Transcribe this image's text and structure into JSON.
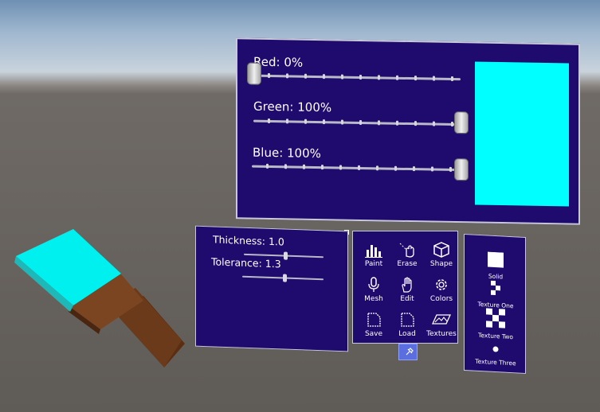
{
  "color_panel": {
    "red_label": "Red: 0%",
    "green_label": "Green: 100%",
    "blue_label": "Blue: 100%",
    "red_value": 0,
    "green_value": 1,
    "blue_value": 1,
    "preview_color": "#00ffff"
  },
  "brush_panel": {
    "thickness_label": "Thickness: 1.0",
    "tolerance_label": "Tolerance: 1.3"
  },
  "tools": {
    "paint": "Paint",
    "erase": "Erase",
    "shape": "Shape",
    "mesh": "Mesh",
    "edit": "Edit",
    "colors": "Colors",
    "save": "Save",
    "load": "Load",
    "textures": "Textures"
  },
  "textures": {
    "solid": "Solid",
    "texture_one": "Texture One",
    "texture_two": "Texture Two",
    "texture_three": "Texture Three"
  },
  "colors": {
    "panel_bg": "#1f0a6e",
    "brush_tip": "#00ffff",
    "brush_handle": "#6b3a1a"
  },
  "icons": {
    "paint": "bar-chart-icon",
    "erase": "hand-icon",
    "shape": "cube-icon",
    "mesh": "microphone-icon",
    "edit": "hand-icon",
    "colors": "gear-icon",
    "save": "document-icon",
    "load": "document-icon",
    "textures": "image-icon",
    "pin": "pin-icon"
  }
}
